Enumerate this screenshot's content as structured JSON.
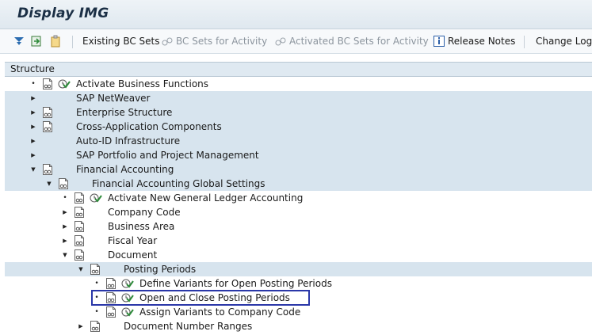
{
  "window": {
    "title": "Display IMG"
  },
  "toolbar": {
    "existing_bc_sets": "Existing BC Sets",
    "bc_sets_for_activity": "BC Sets for Activity",
    "activated_bc_sets_for_activity": "Activated BC Sets for Activity",
    "release_notes": "Release Notes",
    "change_log": "Change Log"
  },
  "tree": {
    "header": "Structure",
    "rows": [
      {
        "label": "Activate Business Functions",
        "level": 0,
        "expander": "leaf",
        "icons": [
          "doc",
          "check"
        ],
        "shaded": false
      },
      {
        "label": "SAP NetWeaver",
        "level": 0,
        "expander": "collapsed",
        "icons": [],
        "shaded": true
      },
      {
        "label": "Enterprise Structure",
        "level": 0,
        "expander": "collapsed",
        "icons": [
          "doc"
        ],
        "shaded": true
      },
      {
        "label": "Cross-Application Components",
        "level": 0,
        "expander": "collapsed",
        "icons": [
          "doc"
        ],
        "shaded": true
      },
      {
        "label": "Auto-ID Infrastructure",
        "level": 0,
        "expander": "collapsed",
        "icons": [],
        "shaded": true
      },
      {
        "label": "SAP Portfolio and Project Management",
        "level": 0,
        "expander": "collapsed",
        "icons": [],
        "shaded": true
      },
      {
        "label": "Financial Accounting",
        "level": 0,
        "expander": "expanded",
        "icons": [
          "doc"
        ],
        "shaded": true
      },
      {
        "label": "Financial Accounting Global Settings",
        "level": 1,
        "expander": "expanded",
        "icons": [
          "doc"
        ],
        "shaded": true
      },
      {
        "label": "Activate New General Ledger Accounting",
        "level": 2,
        "expander": "leaf",
        "icons": [
          "doc",
          "check"
        ],
        "shaded": false
      },
      {
        "label": "Company Code",
        "level": 2,
        "expander": "collapsed",
        "icons": [
          "doc"
        ],
        "shaded": false
      },
      {
        "label": "Business Area",
        "level": 2,
        "expander": "collapsed",
        "icons": [
          "doc"
        ],
        "shaded": false
      },
      {
        "label": "Fiscal Year",
        "level": 2,
        "expander": "collapsed",
        "icons": [
          "doc"
        ],
        "shaded": false
      },
      {
        "label": "Document",
        "level": 2,
        "expander": "expanded",
        "icons": [
          "doc"
        ],
        "shaded": false
      },
      {
        "label": "Posting Periods",
        "level": 3,
        "expander": "expanded",
        "icons": [
          "doc"
        ],
        "shaded": true
      },
      {
        "label": "Define Variants for Open Posting Periods",
        "level": 4,
        "expander": "leaf",
        "icons": [
          "doc",
          "check"
        ],
        "shaded": false
      },
      {
        "label": "Open and Close Posting Periods",
        "level": 4,
        "expander": "leaf",
        "icons": [
          "doc",
          "check"
        ],
        "shaded": false
      },
      {
        "label": "Assign Variants to Company Code",
        "level": 4,
        "expander": "leaf",
        "icons": [
          "doc",
          "check"
        ],
        "shaded": false
      },
      {
        "label": "Document Number Ranges",
        "level": 3,
        "expander": "collapsed",
        "icons": [
          "doc"
        ],
        "shaded": false
      }
    ]
  },
  "colors": {
    "accent": "#2a37a8",
    "row_shade": "#d7e4ee",
    "check_green": "#2e8b3a"
  }
}
